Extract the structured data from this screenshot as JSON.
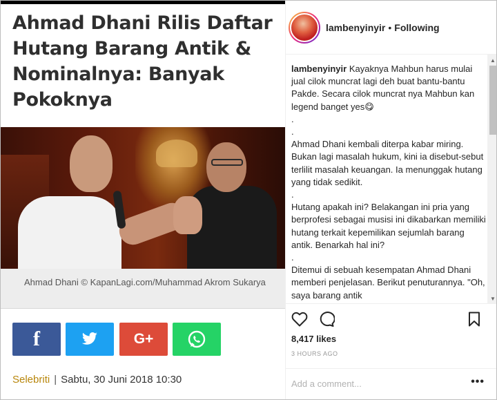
{
  "article": {
    "headline": "Ahmad Dhani Rilis Daftar Hutang Barang Antik & Nominalnya: Banyak Pokoknya",
    "caption": "Ahmad Dhani © KapanLagi.com/Muhammad Akrom Sukarya",
    "share": {
      "facebook": "f",
      "twitter": "twitter-bird",
      "googleplus": "G+",
      "whatsapp": "whatsapp-icon"
    },
    "category": "Selebriti",
    "separator": "|",
    "date": "Sabtu, 30 Juni 2018 10:30",
    "colors": {
      "facebook": "#3b5998",
      "twitter": "#1da1f2",
      "googleplus": "#dd4b39",
      "whatsapp": "#25d366",
      "category": "#b8860b"
    }
  },
  "instagram": {
    "username": "lambenyinyir",
    "separator": "•",
    "follow_status": "Following",
    "caption_user": "lambenyinyir",
    "caption_text": " Kayaknya Mahbun harus mulai jual cilok muncrat lagi deh buat bantu-bantu Pakde. Secara cilok muncrat nya Mahbun kan legend banget yes😋\n.\n.\nAhmad Dhani kembali diterpa kabar miring. Bukan lagi masalah hukum, kini ia disebut-sebut terlilit masalah keuangan. Ia menunggak hutang yang tidak sedikit.\n.\nHutang apakah ini? Belakangan ini pria yang berprofesi sebagai musisi ini dikabarkan memiliki hutang terkait kepemilikan sejumlah barang antik. Benarkah hal ini?\n.\nDitemui di sebuah kesempatan Ahmad Dhani memberi penjelasan. Berikut penuturannya. \"Oh, saya barang antik",
    "likes": "8,417 likes",
    "time_ago": "3 HOURS AGO",
    "comment_placeholder": "Add a comment...",
    "more": "•••",
    "icons": [
      "heart-icon",
      "comment-icon",
      "bookmark-icon"
    ]
  }
}
